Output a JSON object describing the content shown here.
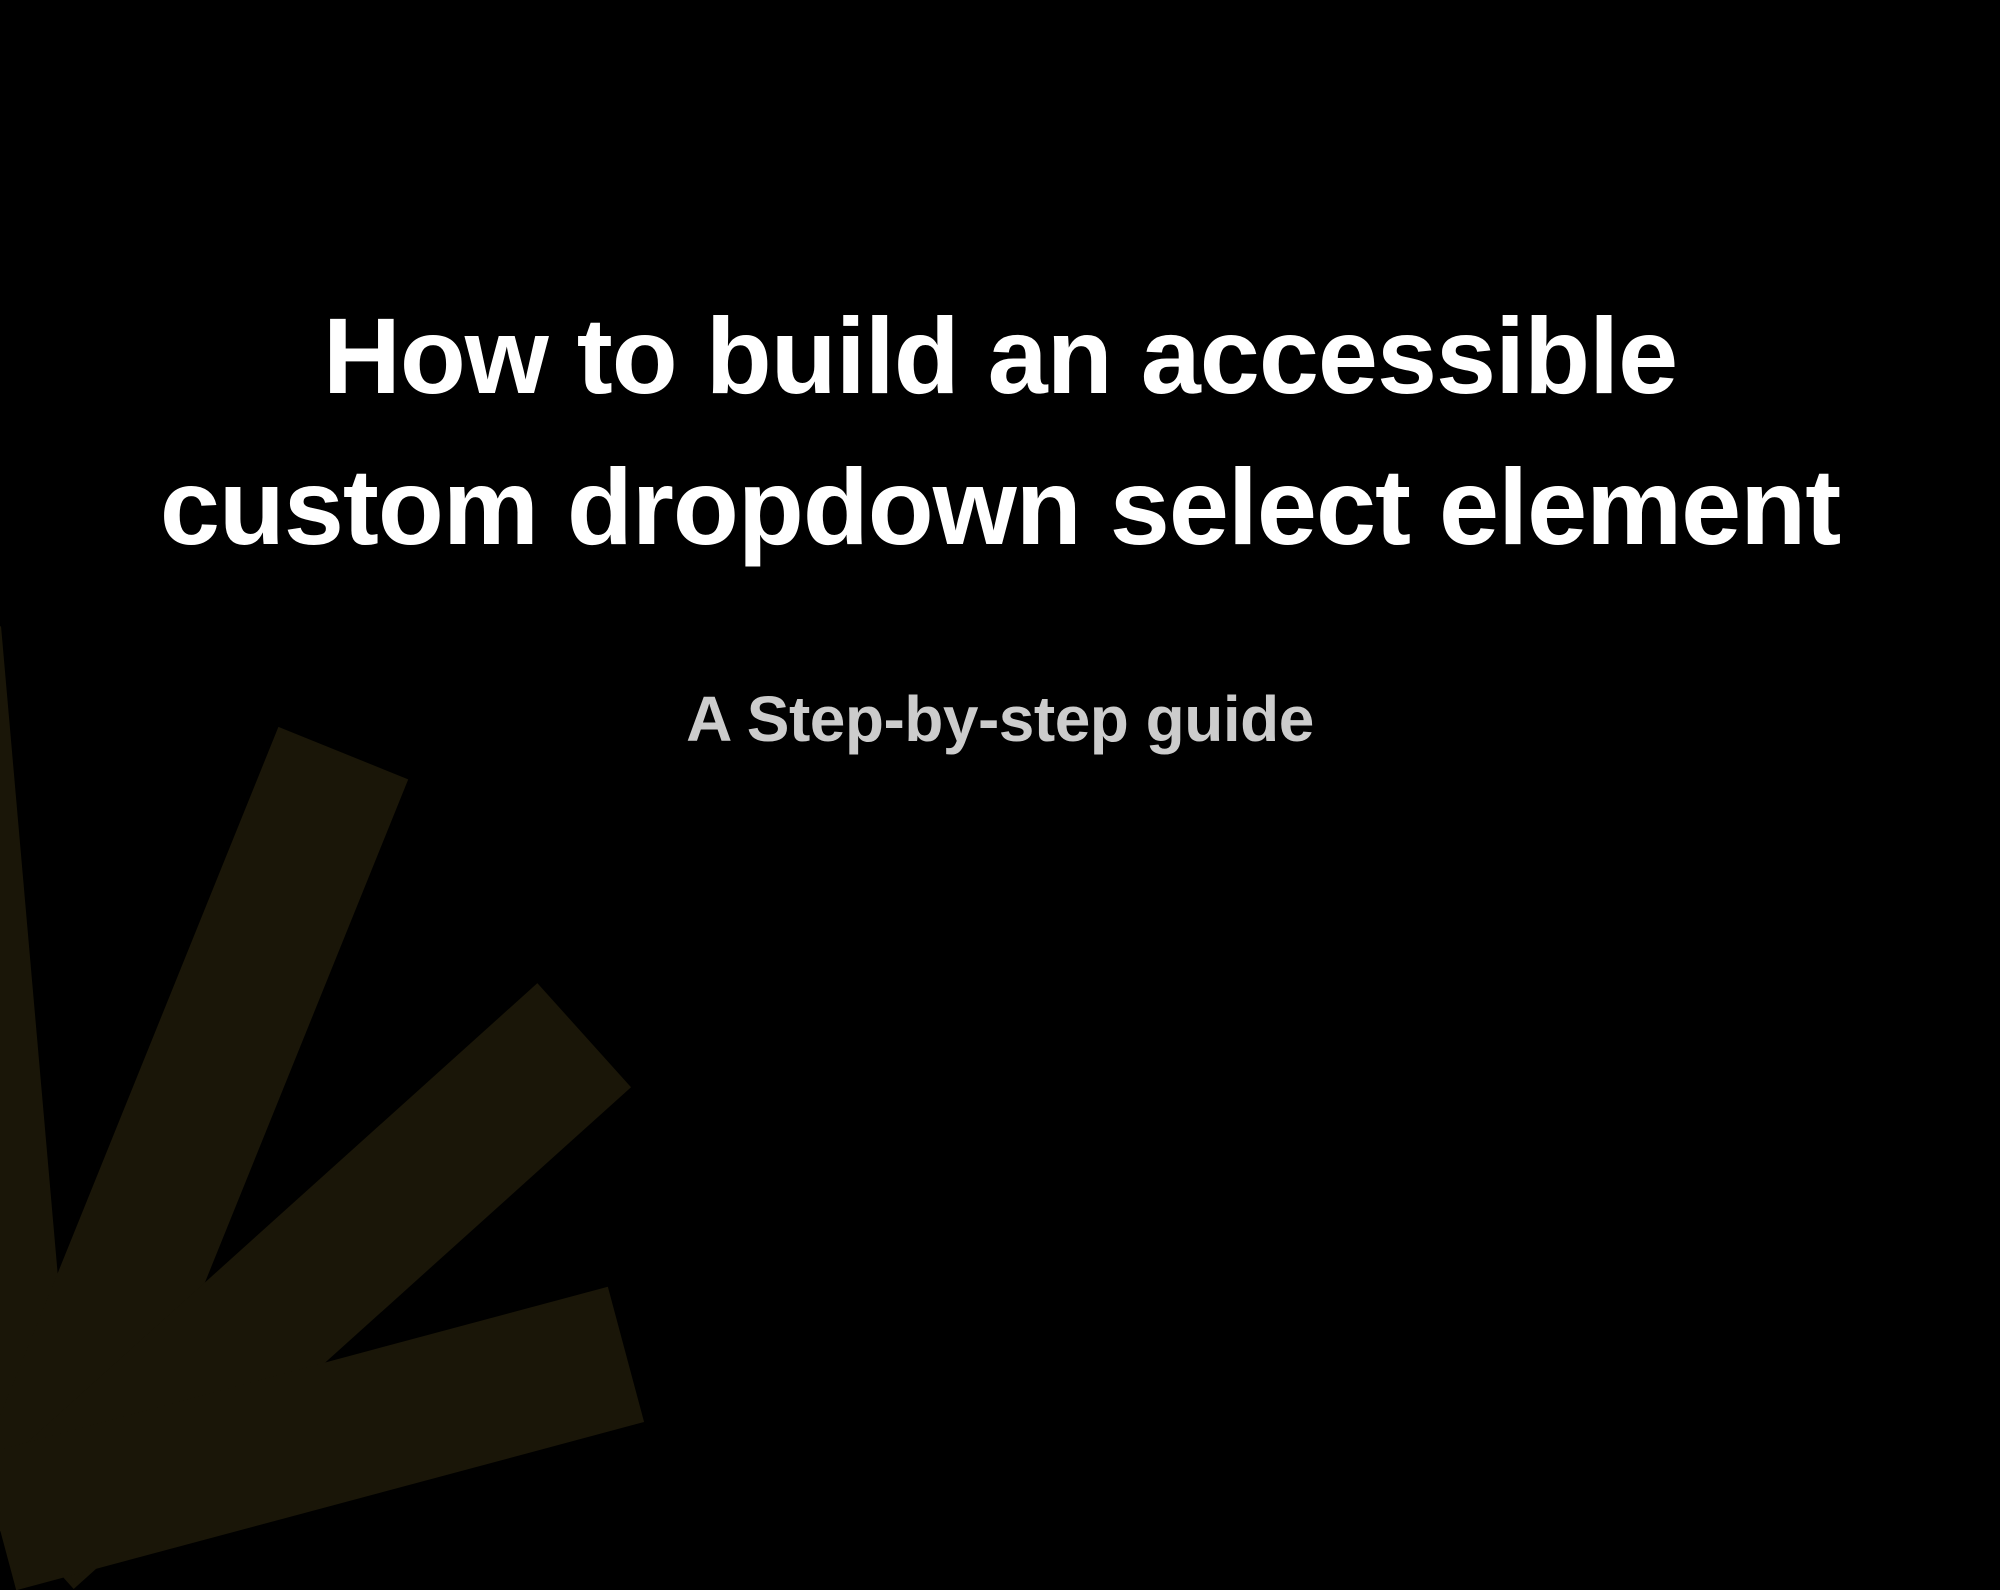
{
  "slide": {
    "title": "How to build an accessible custom dropdown select element",
    "subtitle": "A Step-by-step guide"
  }
}
